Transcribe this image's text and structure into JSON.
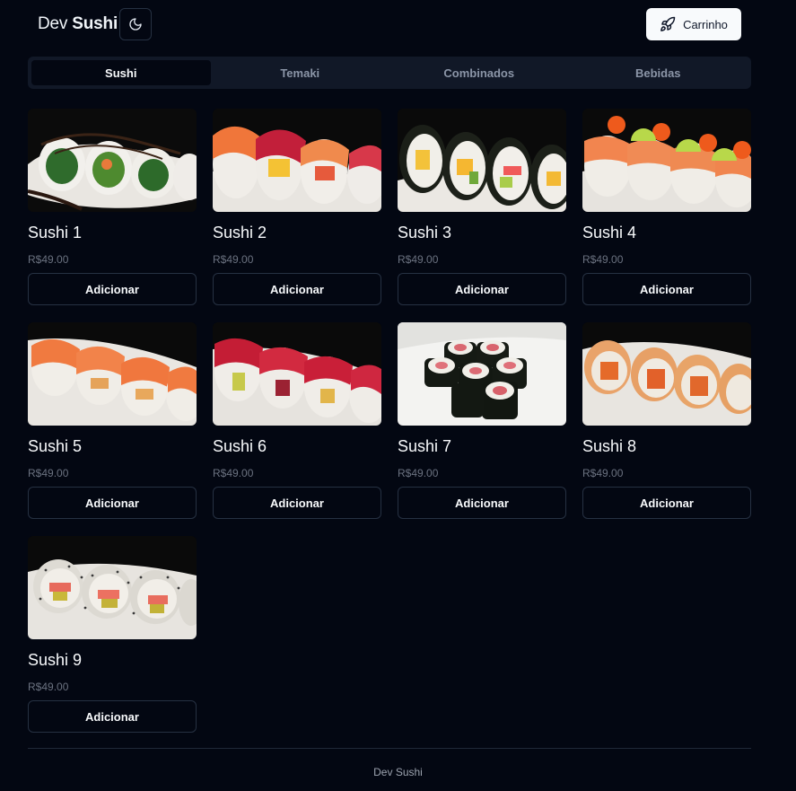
{
  "header": {
    "brand_light": "Dev",
    "brand_bold": "Sushi",
    "theme_icon": "moon-icon",
    "cart_icon": "rocket-icon",
    "cart_label": "Carrinho"
  },
  "tabs": [
    {
      "label": "Sushi",
      "active": true
    },
    {
      "label": "Temaki",
      "active": false
    },
    {
      "label": "Combinados",
      "active": false
    },
    {
      "label": "Bebidas",
      "active": false
    }
  ],
  "products": [
    {
      "name": "Sushi 1",
      "price": "R$49.00",
      "button": "Adicionar"
    },
    {
      "name": "Sushi 2",
      "price": "R$49.00",
      "button": "Adicionar"
    },
    {
      "name": "Sushi 3",
      "price": "R$49.00",
      "button": "Adicionar"
    },
    {
      "name": "Sushi 4",
      "price": "R$49.00",
      "button": "Adicionar"
    },
    {
      "name": "Sushi 5",
      "price": "R$49.00",
      "button": "Adicionar"
    },
    {
      "name": "Sushi 6",
      "price": "R$49.00",
      "button": "Adicionar"
    },
    {
      "name": "Sushi 7",
      "price": "R$49.00",
      "button": "Adicionar"
    },
    {
      "name": "Sushi 8",
      "price": "R$49.00",
      "button": "Adicionar"
    },
    {
      "name": "Sushi 9",
      "price": "R$49.00",
      "button": "Adicionar"
    }
  ],
  "footer": {
    "text": "Dev Sushi"
  },
  "colors": {
    "background": "#030712",
    "tab_bar": "#111827",
    "border": "#263142",
    "muted": "#6b7280"
  }
}
